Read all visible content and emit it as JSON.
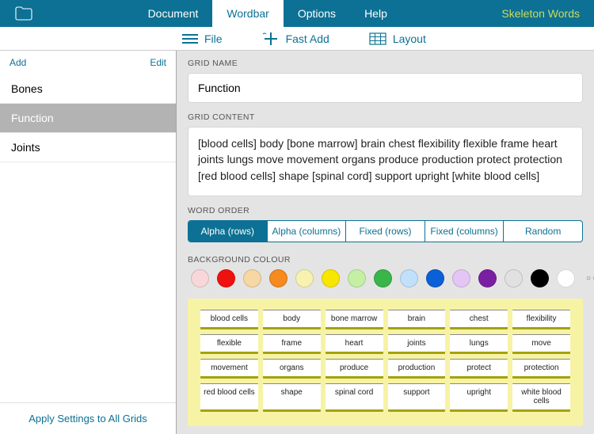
{
  "header": {
    "tabs": [
      "Document",
      "Wordbar",
      "Options",
      "Help"
    ],
    "active_tab_index": 1,
    "title": "Skeleton Words"
  },
  "subbar": {
    "file": "File",
    "fast_add": "Fast Add",
    "layout": "Layout"
  },
  "sidebar": {
    "add": "Add",
    "edit": "Edit",
    "items": [
      "Bones",
      "Function",
      "Joints"
    ],
    "selected_index": 1,
    "apply_all": "Apply Settings to All Grids"
  },
  "labels": {
    "grid_name": "GRID NAME",
    "grid_content": "GRID CONTENT",
    "word_order": "WORD ORDER",
    "background_colour": "BACKGROUND COLOUR"
  },
  "grid_name": "Function",
  "grid_content": "[blood cells] body [bone marrow] brain chest flexibility flexible frame heart joints lungs move movement organs produce production protect protection [red blood cells] shape [spinal cord] support upright [white blood cells]",
  "word_order": {
    "items": [
      "Alpha (rows)",
      "Alpha (columns)",
      "Fixed (rows)",
      "Fixed (columns)",
      "Random"
    ],
    "active_index": 0
  },
  "colors": [
    "#f8d7da",
    "#ef1010",
    "#f7d7a3",
    "#f58a1f",
    "#f7f2b0",
    "#f9e600",
    "#c5f0a3",
    "#39b54a",
    "#c1e0fb",
    "#0a60d6",
    "#e3c6f5",
    "#7b1fa2",
    "#e1e1e1",
    "#000000",
    "#ffffff"
  ],
  "preview_words": [
    "blood cells",
    "body",
    "bone marrow",
    "brain",
    "chest",
    "flexibility",
    "flexible",
    "frame",
    "heart",
    "joints",
    "lungs",
    "move",
    "movement",
    "organs",
    "produce",
    "production",
    "protect",
    "protection",
    "red blood cells",
    "shape",
    "spinal cord",
    "support",
    "upright",
    "white blood cells"
  ]
}
